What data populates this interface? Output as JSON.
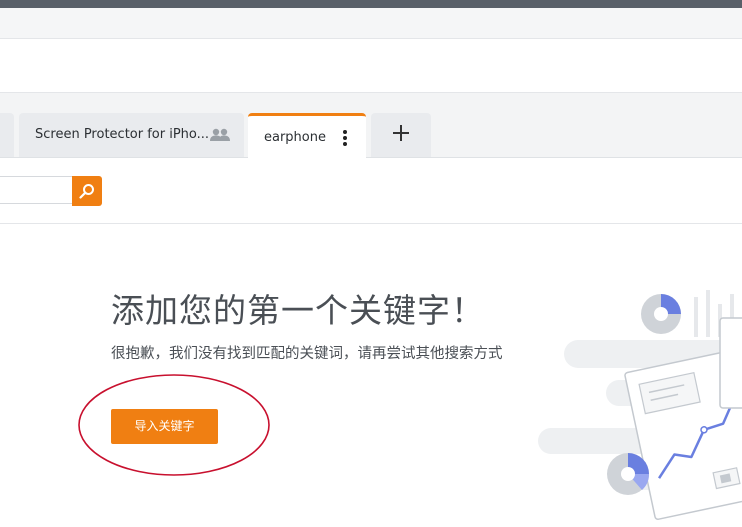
{
  "tabs": {
    "items": [
      {
        "label": "Screen Protector for iPho...",
        "shared": true
      },
      {
        "label": "earphone",
        "active": true
      }
    ],
    "add_label": "+"
  },
  "search": {
    "value": "",
    "button_icon": "search-icon"
  },
  "empty_state": {
    "title": "添加您的第一个关键字！",
    "description": "很抱歉，我们没有找到匹配的关键词，请再尝试其他搜索方式",
    "import_button": "导入关键字"
  },
  "colors": {
    "accent": "#f07f12",
    "annotation": "#c8102e",
    "topbar": "#596069",
    "chart_blue": "#6a7fe0"
  }
}
